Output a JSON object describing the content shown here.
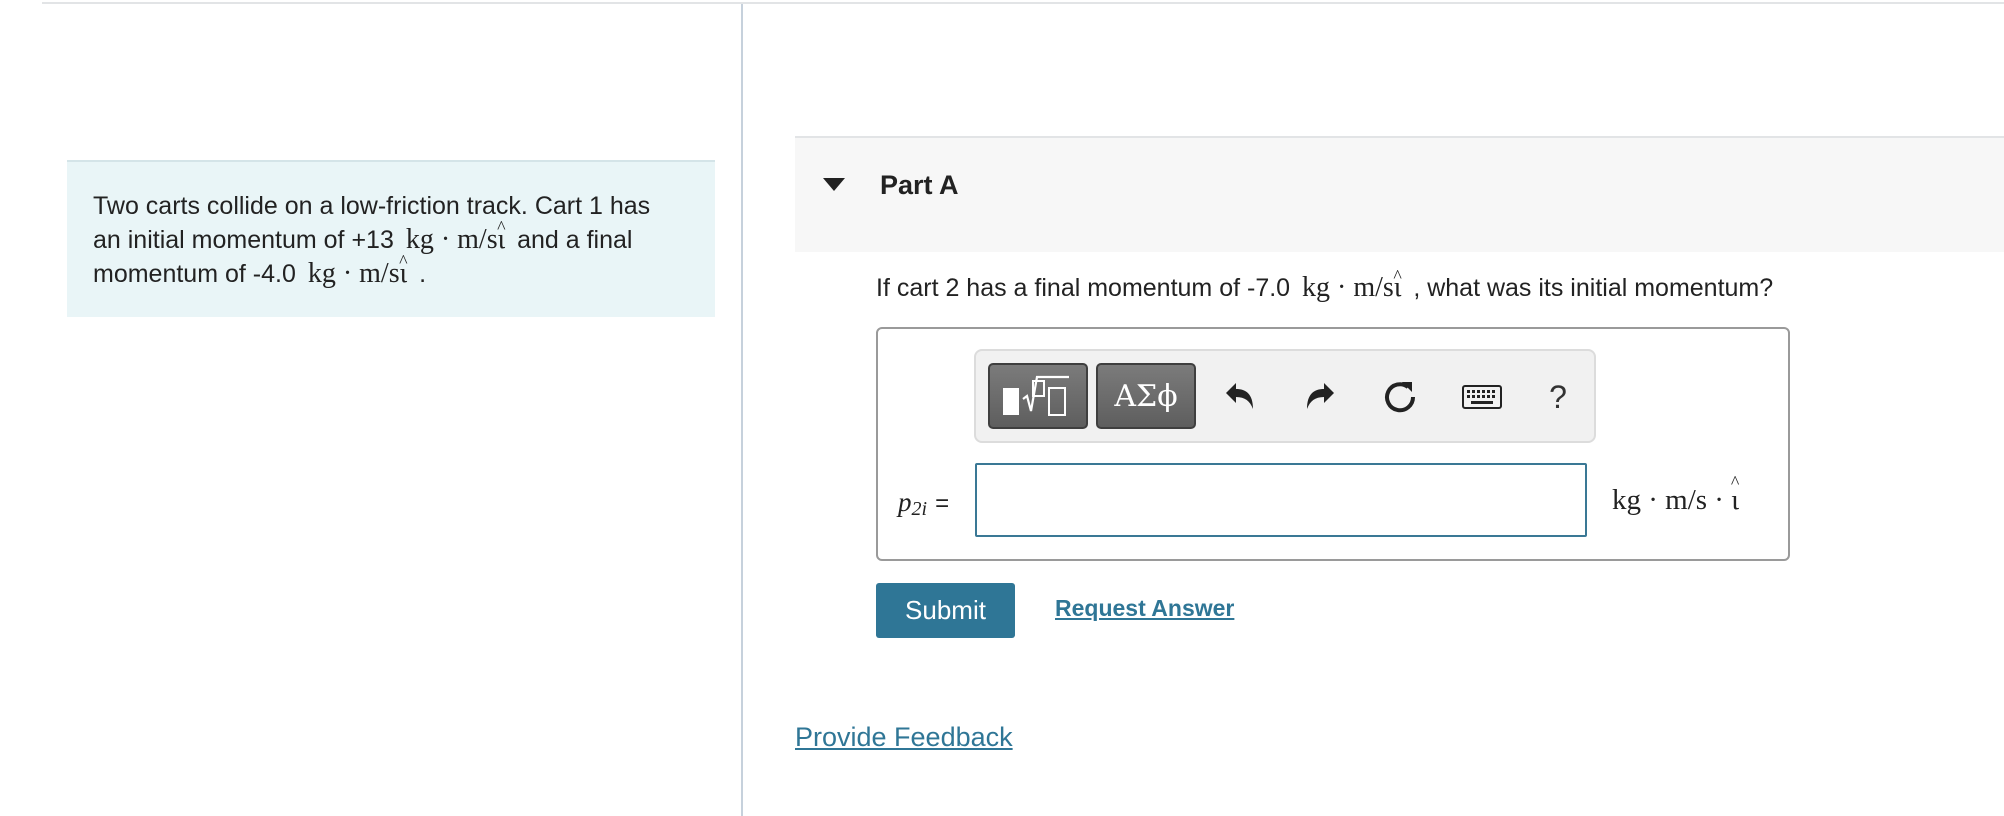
{
  "intro": {
    "line1": "Two carts collide on a low-friction track. Cart 1 has",
    "line2_a": "an initial momentum of +13",
    "line2_b": "and a final",
    "line3_a": "momentum of -4.0",
    "line3_b": "."
  },
  "units": {
    "momentum": "kg · m/s",
    "unit_vector": "ι"
  },
  "part": {
    "title": "Part A"
  },
  "question": {
    "before": "If cart 2 has a final momentum of -7.0",
    "after": ", what was its initial momentum?"
  },
  "toolbar": {
    "greek_label": "ΑΣϕ",
    "help_label": "?",
    "icons": [
      "templates-icon",
      "greek-letters-icon",
      "undo-icon",
      "redo-icon",
      "reset-icon",
      "keyboard-icon",
      "help-icon"
    ]
  },
  "answer": {
    "variable": "p",
    "subscript": "2i",
    "equals": "=",
    "value": "",
    "unit_text": "kg · m/s ·"
  },
  "actions": {
    "submit_label": "Submit",
    "request_answer_label": "Request Answer"
  },
  "footer": {
    "feedback_label": "Provide Feedback"
  },
  "colors": {
    "accent": "#2f7696",
    "intro_bg": "#e9f5f7",
    "part_band_bg": "#f7f7f7"
  }
}
